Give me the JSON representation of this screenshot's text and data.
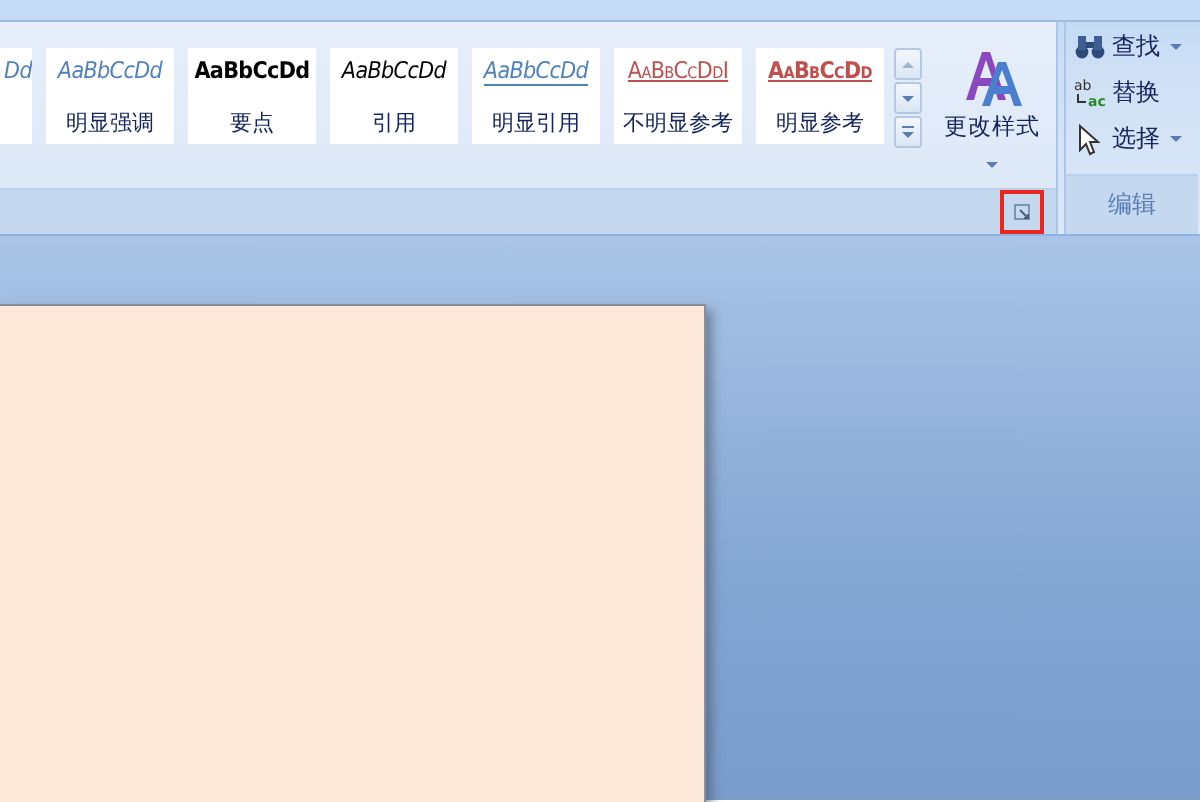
{
  "styles_gallery": {
    "items": [
      {
        "sample": "Dd",
        "kind": "emphasis",
        "partial": true
      },
      {
        "sample": "AaBbCcDd",
        "name": "明显强调",
        "kind": "emphasis",
        "partial": false
      },
      {
        "sample": "AaBbCcDd",
        "name": "要点",
        "kind": "strong",
        "partial": false
      },
      {
        "sample": "AaBbCcDd",
        "name": "引用",
        "kind": "quote",
        "partial": false
      },
      {
        "sample": "AaBbCcDd",
        "name": "明显引用",
        "kind": "intense-quote",
        "partial": false
      },
      {
        "sample": "AaBbCcDdI",
        "name": "不明显参考",
        "kind": "subtle-ref",
        "partial": false
      },
      {
        "sample": "AaBbCcDd",
        "name": "明显参考",
        "kind": "intense-ref",
        "partial": false
      }
    ],
    "change_styles": "更改样式",
    "launcher_highlighted": true
  },
  "editing_group": {
    "label": "编辑",
    "items": [
      {
        "label": "查找",
        "kind": "find",
        "dropdown": true
      },
      {
        "label": "替换",
        "kind": "replace",
        "dropdown": false,
        "icon_letters": [
          "ab",
          "ac"
        ]
      },
      {
        "label": "选择",
        "kind": "select",
        "dropdown": true
      }
    ]
  }
}
